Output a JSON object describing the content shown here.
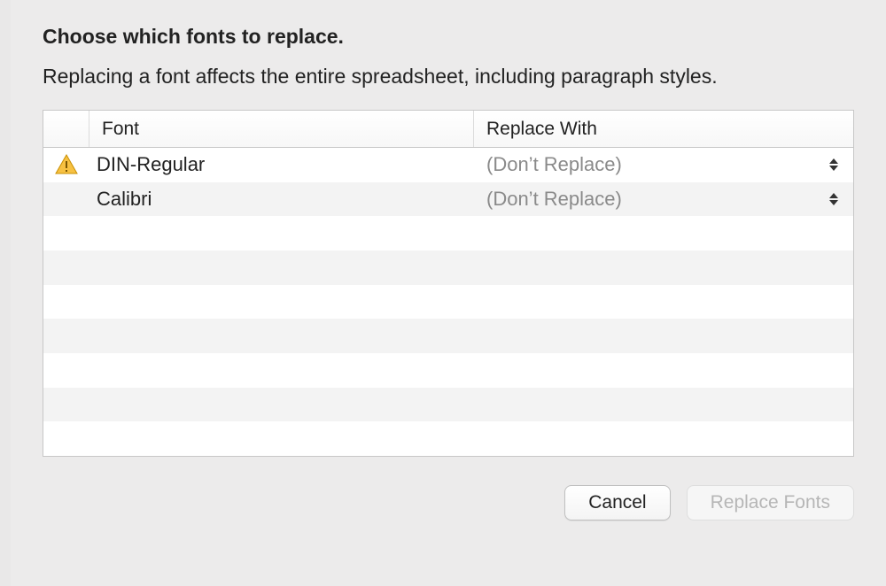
{
  "dialog": {
    "title": "Choose which fonts to replace.",
    "subtitle": "Replacing a font affects the entire spreadsheet, including paragraph styles."
  },
  "table": {
    "headers": {
      "font": "Font",
      "replace_with": "Replace With"
    },
    "rows": [
      {
        "warning": true,
        "font": "DIN-Regular",
        "replace_with": "(Don’t Replace)"
      },
      {
        "warning": false,
        "font": "Calibri",
        "replace_with": "(Don’t Replace)"
      }
    ]
  },
  "buttons": {
    "cancel": "Cancel",
    "replace": "Replace Fonts"
  }
}
